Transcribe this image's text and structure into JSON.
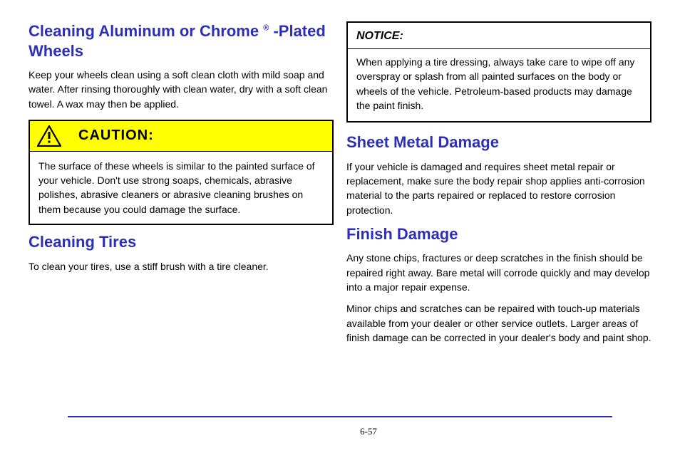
{
  "left": {
    "heading_prefix": "Cleaning Aluminum or Chrome",
    "heading_suffix": "-Plated Wheels",
    "reg": "®",
    "p1": "Keep your wheels clean using a soft clean cloth with mild soap and water. After rinsing thoroughly with clean water, dry with a soft clean towel. A wax may then be applied.",
    "caution_label": "CAUTION:",
    "caution_body": "The surface of these wheels is similar to the painted surface of your vehicle. Don't use strong soaps, chemicals, abrasive polishes, abrasive cleaners or abrasive cleaning brushes on them because you could damage the surface.",
    "heading2": "Cleaning Tires",
    "p2": "To clean your tires, use a stiff brush with a tire cleaner."
  },
  "right": {
    "notice_label": "NOTICE:",
    "notice_body": "When applying a tire dressing, always take care to wipe off any overspray or splash from all painted surfaces on the body or wheels of the vehicle. Petroleum-based products may damage the paint finish.",
    "heading": "Sheet Metal Damage",
    "p1": "If your vehicle is damaged and requires sheet metal repair or replacement, make sure the body repair shop applies anti-corrosion material to the parts repaired or replaced to restore corrosion protection.",
    "heading2": "Finish Damage",
    "p2": "Any stone chips, fractures or deep scratches in the finish should be repaired right away. Bare metal will corrode quickly and may develop into a major repair expense.",
    "p3": "Minor chips and scratches can be repaired with touch-up materials available from your dealer or other service outlets. Larger areas of finish damage can be corrected in your dealer's body and paint shop."
  },
  "footer": "6-57"
}
